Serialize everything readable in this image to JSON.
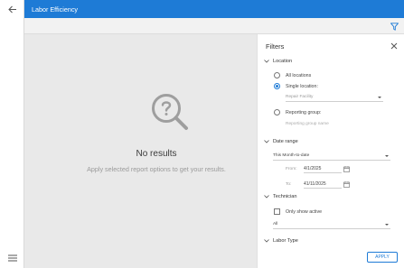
{
  "header": {
    "title": "Labor Efficiency"
  },
  "icons": {
    "back": "arrow-left-icon",
    "menu": "hamburger-icon",
    "filter": "funnel-icon",
    "close": "close-icon",
    "empty": "search-question-icon"
  },
  "colors": {
    "accent": "#1e7bd6",
    "toolbar": "#f2f2f2",
    "main_bg": "#e9e9e9"
  },
  "main": {
    "empty_title": "No results",
    "empty_subtitle": "Apply selected report options to get your results."
  },
  "filters": {
    "title": "Filters",
    "location": {
      "label": "Location",
      "all_label": "All locations",
      "single_label": "Single location:",
      "single_selected": true,
      "single_value": "Repair Facility",
      "group_label": "Reporting group:",
      "group_placeholder": "Reporting group name"
    },
    "date_range": {
      "label": "Date range",
      "preset": "This Month-to-date",
      "from_label": "From:",
      "from_value": "4/1/2025",
      "to_label": "To:",
      "to_value": "41/11/2025"
    },
    "technician": {
      "label": "Technician",
      "only_active_label": "Only show active",
      "only_active_checked": false,
      "selection": "All"
    },
    "labor_type": {
      "label": "Labor Type"
    },
    "apply_label": "APPLY"
  }
}
